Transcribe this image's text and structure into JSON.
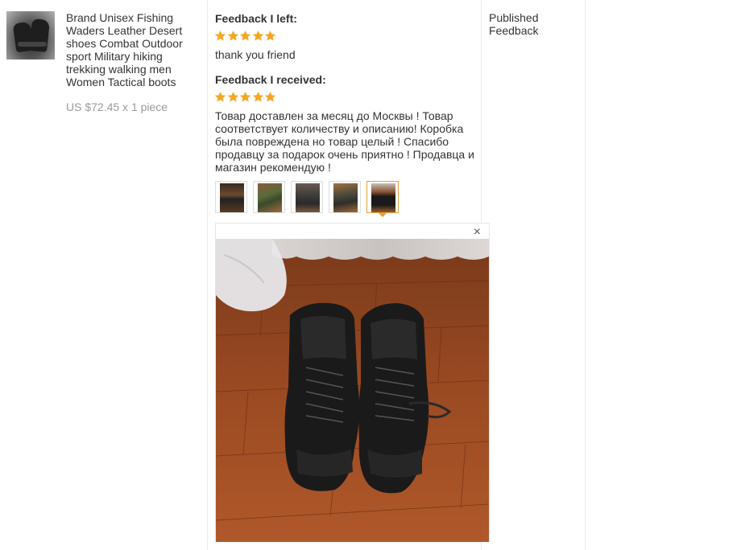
{
  "product": {
    "title": "Brand Unisex Fishing Waders Leather Desert shoes Combat Outdoor sport Military hiking trekking walking men Women Tactical boots",
    "price": "US $72.45 x 1 piece",
    "thumbnail_icon": "product-photo-boots"
  },
  "feedback_left": {
    "label": "Feedback I left:",
    "rating": 5,
    "text": "thank you friend"
  },
  "feedback_received": {
    "label": "Feedback I received:",
    "rating": 5,
    "text": "Товар доставлен за месяц до Москвы ! Товар соответствует количеству и описанию! Коробка была повреждена но товар целый ! Спасибо продавцу за подарок очень приятно ! Продавца и магазин рекомендую !",
    "photos_count": 5,
    "active_photo_index": 4
  },
  "viewer": {
    "close_symbol": "×"
  },
  "status": {
    "text": "Published Feedback"
  },
  "colors": {
    "star": "#f5a623",
    "active_thumb_border": "#e4a036",
    "divider": "#e9e9e9",
    "price_text": "#999999"
  }
}
